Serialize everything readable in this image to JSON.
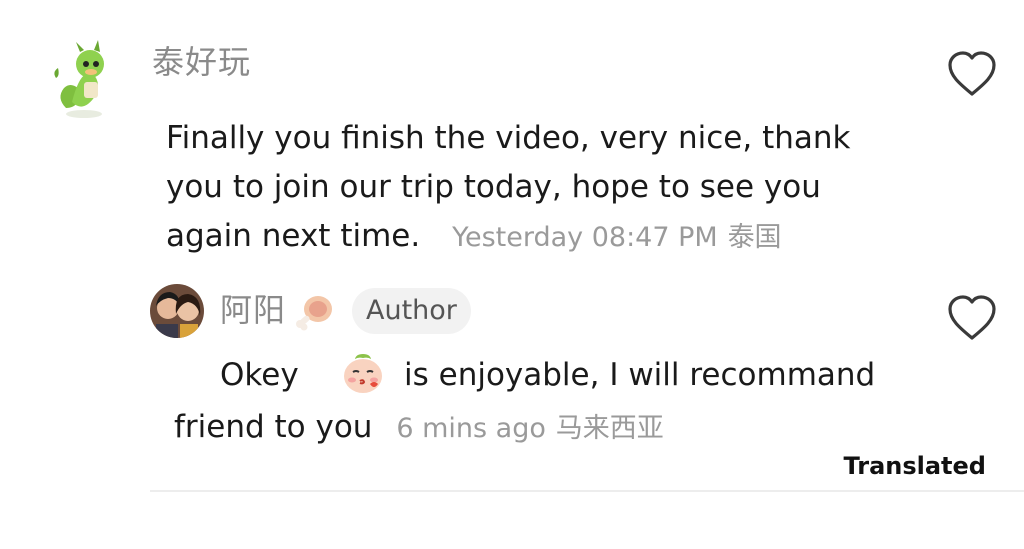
{
  "comment": {
    "username": "泰好玩",
    "text": "Finally you finish the video, very nice, thank you to join our trip today, hope to see you again next time.",
    "timestamp": "Yesterday 08:47 PM",
    "location": "泰国"
  },
  "reply": {
    "username": "阿阳",
    "badge": "Author",
    "text_part1": "Okey",
    "text_part2": "is enjoyable, I will recommand",
    "text_part3": "friend to you",
    "timestamp": "6 mins ago",
    "location": "马来西亚"
  },
  "footer": {
    "translated_label": "Translated"
  },
  "icons": {
    "like": "heart-outline-icon",
    "user_badge": "drumstick-icon",
    "emoji": "kiss-face-emoji"
  },
  "colors": {
    "username": "#8a8a8a",
    "meta": "#9a9a9a",
    "badge_bg": "#f2f2f2",
    "text": "#1a1a1a"
  }
}
